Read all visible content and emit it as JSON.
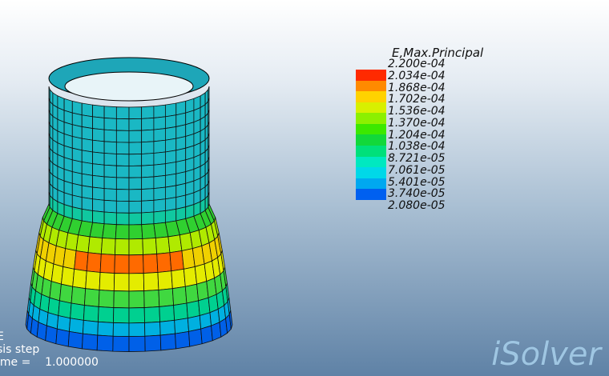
{
  "legend": {
    "title": "E,Max.Principal",
    "labels": [
      "2.200e-04",
      "2.034e-04",
      "1.868e-04",
      "1.702e-04",
      "1.536e-04",
      "1.370e-04",
      "1.204e-04",
      "1.038e-04",
      "8.721e-05",
      "7.061e-05",
      "5.401e-05",
      "3.740e-05",
      "2.080e-05"
    ],
    "colors": [
      "#ff2a00",
      "#ff8a00",
      "#ffd200",
      "#d8f000",
      "#8cf000",
      "#3ce800",
      "#12d83a",
      "#00e07a",
      "#00e8c0",
      "#00d8e8",
      "#00a8f0",
      "#0060f0"
    ]
  },
  "status": {
    "line1": "E",
    "line2": "sis step",
    "line3": "ime =    1.000000"
  },
  "brand": {
    "name": "iSolver"
  }
}
